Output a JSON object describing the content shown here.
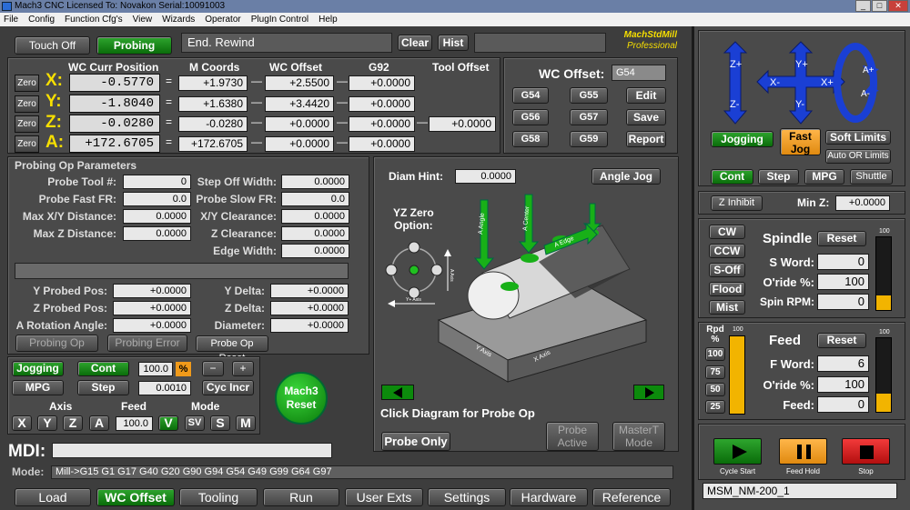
{
  "titlebar": {
    "title": "Mach3 CNC  Licensed To: Novakon Serial:10091003"
  },
  "menu": [
    "File",
    "Config",
    "Function Cfg's",
    "View",
    "Wizards",
    "Operator",
    "PlugIn Control",
    "Help"
  ],
  "top": {
    "touch_off": "Touch Off",
    "probing": "Probing",
    "status": "End. Rewind",
    "clear": "Clear",
    "hist": "Hist",
    "logo1": "MachStdMill",
    "logo2": "Professional"
  },
  "dro_headers": {
    "wc_curr": "WC Curr Position",
    "m_coords": "M Coords",
    "wc_offset": "WC Offset",
    "g92": "G92",
    "tool_offset": "Tool Offset"
  },
  "axes": [
    {
      "name": "X:",
      "zero": "Zero",
      "wc": "-0.5770",
      "m": "+1.9730",
      "off": "+2.5500",
      "g92": "+0.0000"
    },
    {
      "name": "Y:",
      "zero": "Zero",
      "wc": "-1.8040",
      "m": "+1.6380",
      "off": "+3.4420",
      "g92": "+0.0000"
    },
    {
      "name": "Z:",
      "zero": "Zero",
      "wc": "-0.0280",
      "m": "-0.0280",
      "off": "+0.0000",
      "g92": "+0.0000",
      "tool": "+0.0000"
    },
    {
      "name": "A:",
      "zero": "Zero",
      "wc": "+172.6705",
      "m": "+172.6705",
      "off": "+0.0000",
      "g92": "+0.0000"
    }
  ],
  "wcoffset": {
    "label": "WC Offset:",
    "value": "G54",
    "buttons": [
      "G54",
      "G55",
      "Edit",
      "G56",
      "G57",
      "Save",
      "G58",
      "G59",
      "Report"
    ]
  },
  "probe": {
    "title": "Probing Op Parameters",
    "left": [
      {
        "label": "Probe Tool #:",
        "value": "0"
      },
      {
        "label": "Probe Fast FR:",
        "value": "0.0"
      },
      {
        "label": "Max X/Y Distance:",
        "value": "0.0000"
      },
      {
        "label": "Max Z Distance:",
        "value": "0.0000"
      }
    ],
    "right": [
      {
        "label": "Step Off Width:",
        "value": "0.0000"
      },
      {
        "label": "Probe Slow FR:",
        "value": "0.0"
      },
      {
        "label": "X/Y Clearance:",
        "value": "0.0000"
      },
      {
        "label": "Z Clearance:",
        "value": "0.0000"
      },
      {
        "label": "Edge Width:",
        "value": "0.0000"
      }
    ],
    "results_left": [
      {
        "label": "Y Probed Pos:",
        "value": "+0.0000"
      },
      {
        "label": "Z Probed Pos:",
        "value": "+0.0000"
      },
      {
        "label": "A Rotation Angle:",
        "value": "+0.0000"
      }
    ],
    "results_right": [
      {
        "label": "Y Delta:",
        "value": "+0.0000"
      },
      {
        "label": "Z Delta:",
        "value": "+0.0000"
      },
      {
        "label": "Diameter:",
        "value": "+0.0000"
      }
    ],
    "probing_op": "Probing Op",
    "probing_error": "Probing Error",
    "probe_op_reset": "Probe Op Reset"
  },
  "diagram": {
    "diam_hint": "Diam Hint:",
    "diam_value": "0.0000",
    "angle_jog": "Angle Jog",
    "yz_zero": "YZ Zero",
    "option": "Option:",
    "caption": "Click Diagram for Probe Op",
    "probe_only": "Probe Only",
    "probe_active": "Probe Active",
    "master_mode": "MasterT Mode",
    "labels": {
      "a_center": "A Center",
      "a_edge": "A Edge",
      "a_angle": "A Angle",
      "y_axis": "Y Axis",
      "x_axis": "X Axis",
      "a_axis": "A Axis",
      "y_axis2": "Y+ Axis"
    }
  },
  "jog": {
    "jogging": "Jogging",
    "cont": "Cont",
    "rate": "100.0",
    "pct": "%",
    "minus": "−",
    "plus": "+",
    "mpg": "MPG",
    "step": "Step",
    "step_val": "0.0010",
    "cyc_incr": "Cyc Incr",
    "axis": "Axis",
    "feed": "Feed",
    "mode": "Mode",
    "axes": [
      "X",
      "Y",
      "Z",
      "A"
    ],
    "feed_val": "100.0",
    "v": "V",
    "sv": "SV",
    "s": "S",
    "m": "M",
    "reset": "Mach3 Reset"
  },
  "mdi": {
    "label": "MDI:",
    "mode_label": "Mode:",
    "mode_value": "Mill->G15  G1 G17 G40 G20 G90 G94 G54 G49 G99 G64 G97"
  },
  "tabs": [
    "Load",
    "WC Offset",
    "Tooling",
    "Run",
    "User Exts",
    "Settings",
    "Hardware",
    "Reference"
  ],
  "right": {
    "jogging": "Jogging",
    "fast_jog": "Fast Jog",
    "soft_limits": "Soft Limits",
    "auto_or_limits": "Auto OR Limits",
    "cont": "Cont",
    "step": "Step",
    "mpg": "MPG",
    "shuttle": "Shuttle",
    "z_inhibit": "Z Inhibit",
    "min_z": "Min Z:",
    "min_z_val": "+0.0000",
    "jog_labels": {
      "zp": "Z+",
      "zm": "Z-",
      "yp": "Y+",
      "ym": "Y-",
      "xp": "X+",
      "xm": "X-",
      "ap": "A+",
      "am": "A-"
    },
    "coolant": [
      "CW",
      "CCW",
      "S-Off",
      "Flood",
      "Mist"
    ],
    "spindle": {
      "title": "Spindle",
      "reset": "Reset",
      "s_word": "S Word:",
      "s_val": "0",
      "oride": "O'ride %:",
      "oride_val": "100",
      "rpm": "Spin RPM:",
      "rpm_val": "0",
      "bar_max": "100",
      "bar_level": 0.2
    },
    "rpd": {
      "label": "Rpd %",
      "max": "100",
      "buttons": [
        "100",
        "75",
        "50",
        "25"
      ],
      "level": 1.0
    },
    "feed": {
      "title": "Feed",
      "reset": "Reset",
      "f_word": "F Word:",
      "f_val": "6",
      "oride": "O'ride %:",
      "oride_val": "100",
      "feed": "Feed:",
      "feed_val": "0",
      "bar_max": "100",
      "bar_level": 0.25
    },
    "cycle_start": "Cycle Start",
    "feed_hold": "Feed Hold",
    "stop": "Stop",
    "profile": "MSM_NM-200_1"
  },
  "colors": {
    "green": "#12882a",
    "orange": "#f09a1a",
    "red": "#d81a1a",
    "yellow": "#f7df00"
  }
}
